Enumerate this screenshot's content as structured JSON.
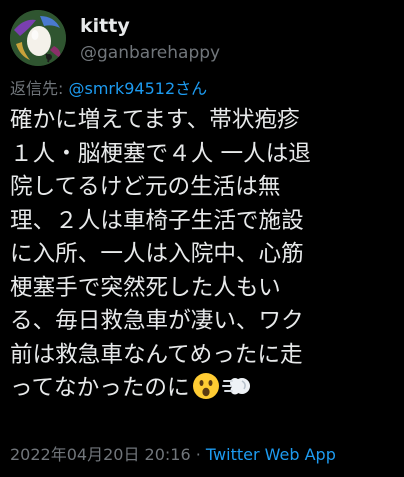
{
  "author": {
    "display_name": "kitty",
    "username": "@ganbarehappy",
    "avatar_icon": "egg-avatar-icon"
  },
  "reply": {
    "prefix": "返信先: ",
    "handle": "@smrk94512さん"
  },
  "tweet": {
    "lines": [
      "確かに増えてます、帯状疱疹",
      "１人・脳梗塞で４人 一人は退",
      "院してるけど元の生活は無",
      "理、２人は車椅子生活で施設",
      "に入所、一人は入院中、心筋",
      "梗塞手で突然死した人もい",
      "る、毎日救急車が凄い、ワク",
      "前は救急車なんてめったに走",
      "ってなかったのに"
    ],
    "emojis": [
      "astonished-face-icon",
      "dashing-away-icon"
    ]
  },
  "footer": {
    "timestamp": "2022年04月20日 20:16",
    "separator": " · ",
    "source": "Twitter Web App"
  },
  "colors": {
    "background": "#000000",
    "text": "#e7e9ea",
    "muted": "#71767b",
    "accent": "#1d9bf0"
  }
}
